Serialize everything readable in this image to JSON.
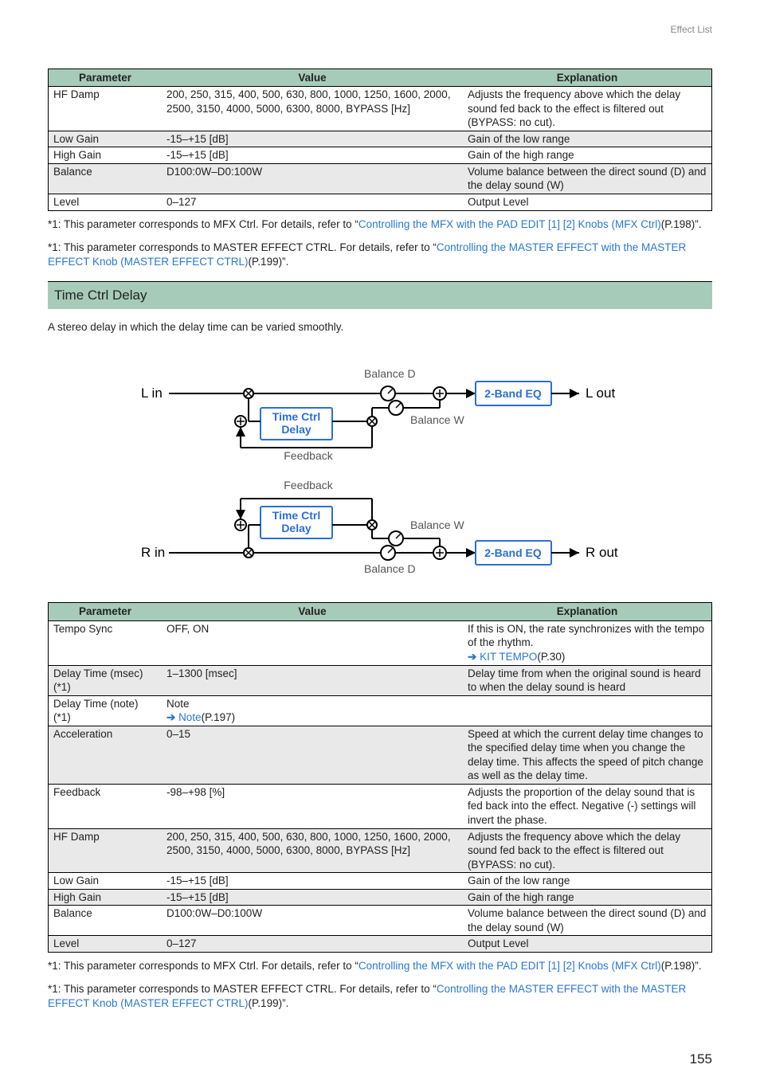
{
  "header_label": "Effect List",
  "page_number": "155",
  "table1": {
    "headers": {
      "p": "Parameter",
      "v": "Value",
      "e": "Explanation"
    },
    "rows": [
      {
        "param": "HF Damp",
        "value": "200, 250, 315, 400, 500, 630, 800, 1000, 1250, 1600, 2000, 2500, 3150, 4000, 5000, 6300, 8000, BYPASS [Hz]",
        "expl": "Adjusts the frequency above which the delay sound fed back to the effect is filtered out (BYPASS: no cut).",
        "shaded": false
      },
      {
        "param": "Low Gain",
        "value": "-15–+15 [dB]",
        "expl": "Gain of the low range",
        "shaded": true
      },
      {
        "param": "High Gain",
        "value": "-15–+15 [dB]",
        "expl": "Gain of the high range",
        "shaded": false
      },
      {
        "param": "Balance",
        "value": "D100:0W–D0:100W",
        "expl": "Volume balance between the direct sound (D) and the delay sound (W)",
        "shaded": true
      },
      {
        "param": "Level",
        "value": "0–127",
        "expl": "Output Level",
        "shaded": false
      }
    ]
  },
  "footnote1_a": "*1: This parameter corresponds to MFX Ctrl. For details, refer to “",
  "footnote1_link": "Controlling the MFX with the PAD EDIT [1] [2] Knobs (MFX Ctrl)",
  "footnote1_b": "(P.198)”.",
  "footnote2_a": "*1: This parameter corresponds to MASTER EFFECT CTRL. For details, refer to “",
  "footnote2_link": "Controlling the MASTER EFFECT with the MASTER EFFECT Knob (MASTER EFFECT CTRL)",
  "footnote2_b": "(P.199)”.",
  "section_title": "Time Ctrl Delay",
  "section_intro": "A stereo delay in which the delay time can be varied smoothly.",
  "diagram": {
    "l_in": "L in",
    "r_in": "R in",
    "l_out": "L out",
    "r_out": "R out",
    "balance_d": "Balance D",
    "balance_w": "Balance W",
    "time_ctrl": "Time Ctrl",
    "delay": "Delay",
    "band_eq": "2-Band EQ",
    "feedback": "Feedback"
  },
  "table2": {
    "headers": {
      "p": "Parameter",
      "v": "Value",
      "e": "Explanation"
    },
    "rows": [
      {
        "param": "Tempo Sync",
        "value": "OFF, ON",
        "expl_a": "If this is ON, the rate synchronizes with the tempo of the rhythm.",
        "expl_link": "KIT TEMPO",
        "expl_b": "(P.30)",
        "shaded": false
      },
      {
        "param": "Delay Time (msec) (*1)",
        "value": "1–1300 [msec]",
        "expl_a": "Delay time from when the original sound is heard to when the delay sound is heard",
        "shaded": true
      },
      {
        "param": "Delay Time (note) (*1)",
        "value_a": "Note",
        "value_link": "Note",
        "value_b": "(P.197)",
        "expl_a": "",
        "shaded": false
      },
      {
        "param": "Acceleration",
        "value": "0–15",
        "expl_a": "Speed at which the current delay time changes to the specified delay time when you change the delay time. This affects the speed of pitch change as well as the delay time.",
        "shaded": true
      },
      {
        "param": "Feedback",
        "value": "-98–+98 [%]",
        "expl_a": "Adjusts the proportion of the delay sound that is fed back into the effect. Negative (-) settings will invert the phase.",
        "shaded": false
      },
      {
        "param": "HF Damp",
        "value": "200, 250, 315, 400, 500, 630, 800, 1000, 1250, 1600, 2000, 2500, 3150, 4000, 5000, 6300, 8000, BYPASS [Hz]",
        "expl_a": "Adjusts the frequency above which the delay sound fed back to the effect is filtered out (BYPASS: no cut).",
        "shaded": true
      },
      {
        "param": "Low Gain",
        "value": "-15–+15 [dB]",
        "expl_a": "Gain of the low range",
        "shaded": false
      },
      {
        "param": "High Gain",
        "value": "-15–+15 [dB]",
        "expl_a": "Gain of the high range",
        "shaded": true
      },
      {
        "param": "Balance",
        "value": "D100:0W–D0:100W",
        "expl_a": "Volume balance between the direct sound (D) and the delay sound (W)",
        "shaded": false
      },
      {
        "param": "Level",
        "value": "0–127",
        "expl_a": "Output Level",
        "shaded": true
      }
    ]
  }
}
